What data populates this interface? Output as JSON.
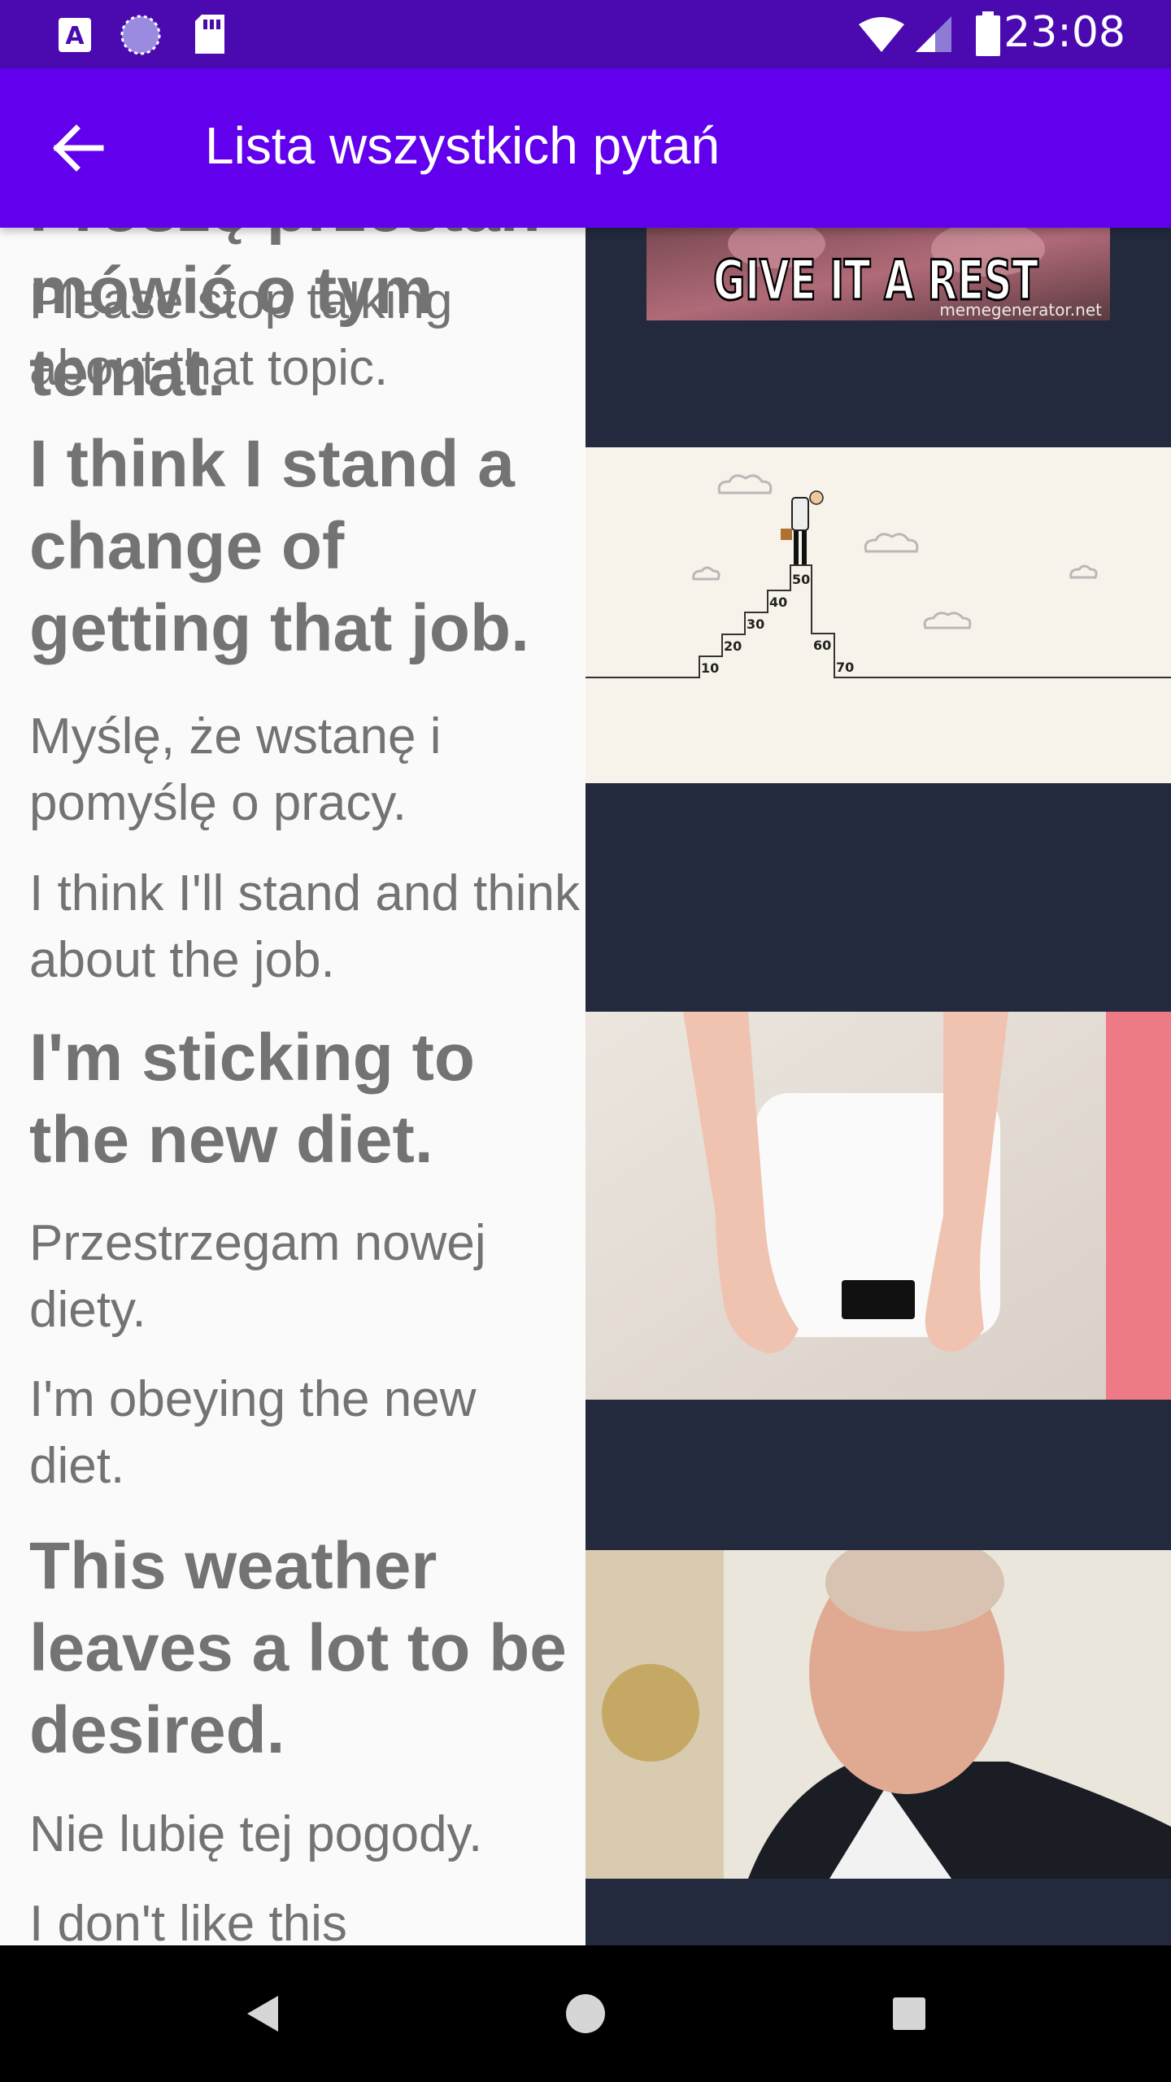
{
  "status_bar": {
    "time": "23:08",
    "left_icons": [
      "text-notification-icon",
      "sync-circle-icon",
      "sd-card-icon"
    ],
    "right_icons": [
      "wifi-icon",
      "cell-signal-icon",
      "battery-icon"
    ]
  },
  "app_bar": {
    "back_icon": "arrow-back-icon",
    "title": "Lista wszystkich pytań",
    "color": "#6200ee"
  },
  "list": {
    "clipped_top_text": "Proszę przestań mówić o tym temat.",
    "items": [
      {
        "answers": [
          "Please stop talking about that topic."
        ],
        "image": {
          "caption": "GIVE IT A REST",
          "watermark": "memegenerator.net"
        }
      },
      {
        "question": "I think I stand a change of getting that job.",
        "answers": [
          "Myślę, że wstanę i pomyślę o pracy.",
          "I think I'll stand and think about the job."
        ],
        "image": {
          "step_labels": [
            "10",
            "20",
            "30",
            "40",
            "50",
            "60",
            "70"
          ]
        }
      },
      {
        "question": "I'm sticking to the new diet.",
        "answers": [
          "Przestrzegam nowej diety.",
          "I'm obeying the new diet."
        ],
        "image": {
          "subject": "feet-on-bathroom-scale"
        }
      },
      {
        "question": "This weather leaves a lot to be desired.",
        "answers": [
          "Nie lubię tej pogody.",
          "I don't like this"
        ],
        "image": {
          "subject": "portrait-man-in-suit"
        }
      }
    ]
  },
  "nav_bar": {
    "buttons": [
      "back-triangle-icon",
      "home-circle-icon",
      "recents-square-icon"
    ]
  },
  "colors": {
    "status_bar": "#4a0ab0",
    "text_gray": "#737373",
    "image_panel_bg": "#232a3e"
  }
}
